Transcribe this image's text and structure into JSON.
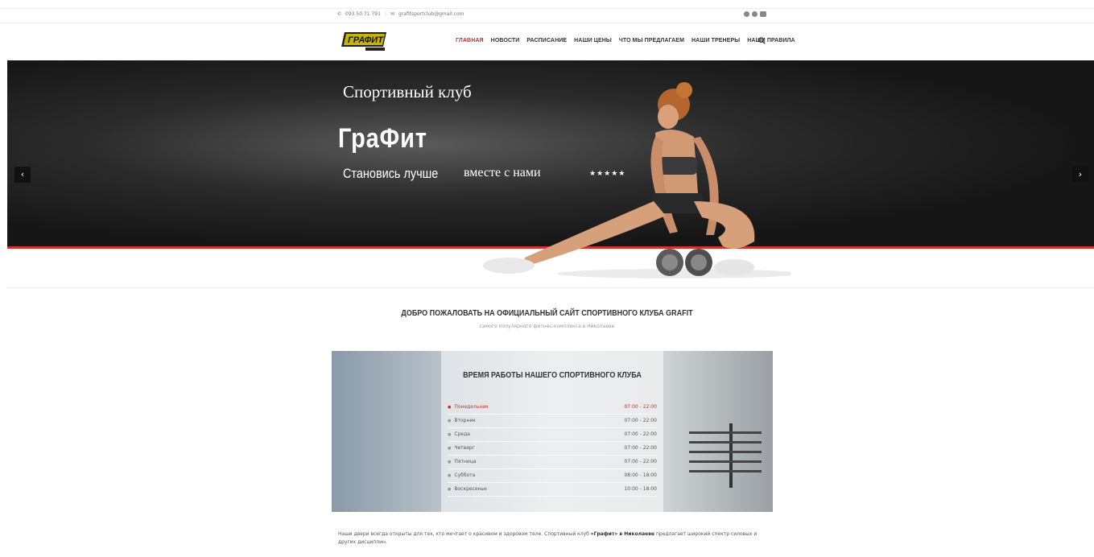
{
  "topbar": {
    "phone": "093 50 71 791",
    "email": "grafitsportclub@gmail.com",
    "separator": "|",
    "social_icons": [
      "facebook-icon",
      "instagram-icon",
      "youtube-icon"
    ]
  },
  "header": {
    "logo_text": "ГРАФИТ",
    "nav": [
      {
        "label": "ГЛАВНАЯ",
        "active": true
      },
      {
        "label": "НОВОСТИ",
        "active": false
      },
      {
        "label": "РАСПИСАНИЕ",
        "active": false
      },
      {
        "label": "НАШИ ЦЕНЫ",
        "active": false
      },
      {
        "label": "ЧТО МЫ ПРЕДЛАГАЕМ",
        "active": false
      },
      {
        "label": "НАШИ ТРЕНЕРЫ",
        "active": false
      },
      {
        "label": "НАШИ ПРАВИЛА",
        "active": false
      }
    ],
    "accent_color": "#c9302c"
  },
  "hero": {
    "subtitle": "Спортивный клуб",
    "title": "ГраФит",
    "tagline_1": "Становись лучше",
    "tagline_2": "вместе с нами",
    "stars": "★★★★★",
    "prev_arrow": "‹",
    "next_arrow": "›",
    "line_color": "#d32f2f"
  },
  "welcome": {
    "title": "ДОБРО ПОЖАЛОВАТЬ НА ОФИЦИАЛЬНЫЙ САЙТ СПОРТИВНОГО КЛУБА GRAFIT",
    "subtitle": "самого популярного фитнес-комплекса в Николаеве"
  },
  "hours": {
    "title": "ВРЕМЯ РАБОТЫ НАШЕГО СПОРТИВНОГО КЛУБА",
    "rows": [
      {
        "day": "Понедельник",
        "time": "07:00 - 22:00",
        "today": true
      },
      {
        "day": "Вторник",
        "time": "07:00 - 22:00",
        "today": false
      },
      {
        "day": "Среда",
        "time": "07:00 - 22:00",
        "today": false
      },
      {
        "day": "Четверг",
        "time": "07:00 - 22:00",
        "today": false
      },
      {
        "day": "Пятница",
        "time": "07:00 - 22:00",
        "today": false
      },
      {
        "day": "Суббота",
        "time": "08:00 - 18:00",
        "today": false
      },
      {
        "day": "Воскресенье",
        "time": "10:00 - 18:00",
        "today": false
      }
    ]
  },
  "intro": {
    "text_1": "Наши двери всегда открыты для тех, кто мечтает о красивом и здоровом теле. Спортивный клуб ",
    "bold": "«Графит» в Николаеве",
    "text_2": " предлагает широкий спектр силовых и других дисциплин."
  }
}
